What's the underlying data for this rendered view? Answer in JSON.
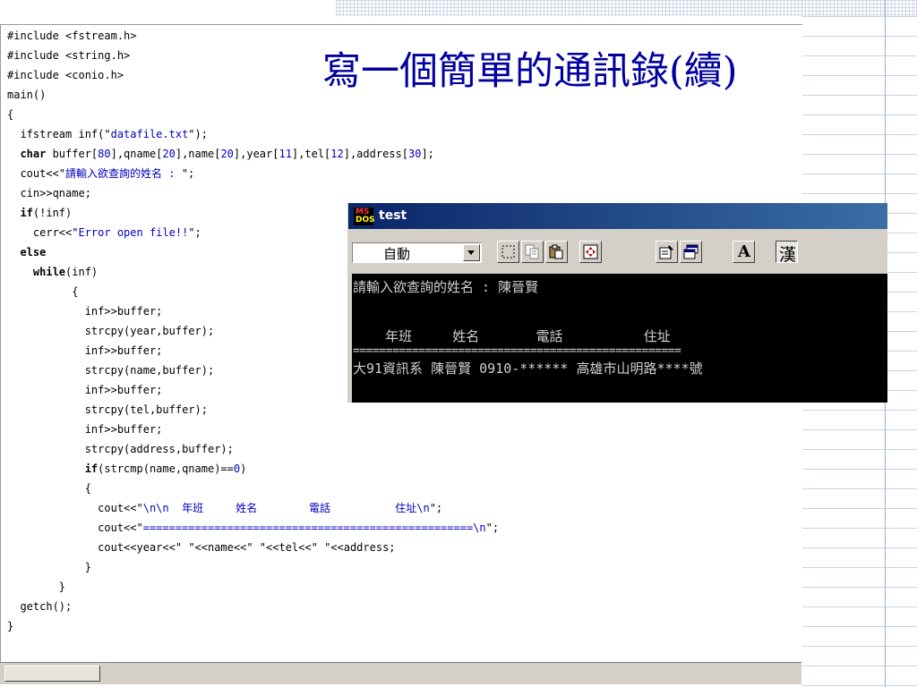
{
  "slide": {
    "title": "寫一個簡單的通訊錄(續)"
  },
  "code": {
    "lines": [
      "#include <fstream.h>",
      "#include <string.h>",
      "#include <conio.h>",
      "main()",
      "{",
      "  ifstream inf(\"datafile.txt\");",
      "  char buffer[80],qname[20],name[20],year[11],tel[12],address[30];",
      "  cout<<\"請輸入欲查詢的姓名 : \";",
      "  cin>>qname;",
      "  if(!inf)",
      "    cerr<<\"Error open file!!\";",
      "  else",
      "    while(inf)",
      "          {",
      "            inf>>buffer;",
      "            strcpy(year,buffer);",
      "            inf>>buffer;",
      "            strcpy(name,buffer);",
      "            inf>>buffer;",
      "            strcpy(tel,buffer);",
      "            inf>>buffer;",
      "            strcpy(address,buffer);",
      "            if(strcmp(name,qname)==0)",
      "            {",
      "              cout<<\"\\n\\n  年班     姓名        電話          住址\\n\";",
      "              cout<<\"===================================================\\n\";",
      "              cout<<year<<\" \"<<name<<\" \"<<tel<<\" \"<<address;",
      "            }",
      "        }",
      "  getch();",
      "}"
    ]
  },
  "console_window": {
    "logo_top": "MS",
    "logo_bottom": "DOS",
    "title": "test",
    "font_select_value": "自動",
    "font_button_label": "A",
    "dbcs_button_label": "漢",
    "output": {
      "prompt": "請輸入欲查詢的姓名 : 陳晉賢",
      "header": "    年班     姓名       電話          住址",
      "rule": "==================================================",
      "record": "大91資訊系 陳晉賢 0910-****** 高雄市山明路****號"
    }
  },
  "colors": {
    "title": "#0000a0",
    "string_literal": "#0000c0",
    "titlebar_start": "#0a246a",
    "titlebar_end": "#3a6ea5"
  },
  "icons": [
    "mark-icon",
    "copy-icon",
    "paste-icon",
    "fullscreen-icon",
    "properties-icon",
    "background-icon",
    "font-icon"
  ]
}
